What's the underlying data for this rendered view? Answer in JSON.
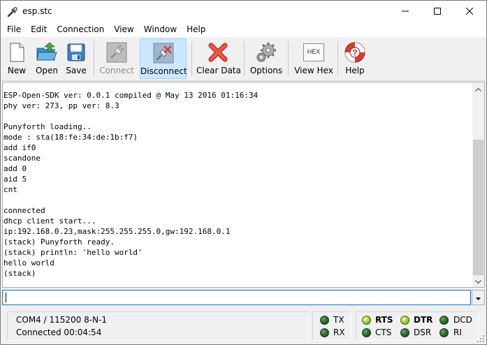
{
  "window": {
    "title": "esp.stc",
    "app_icon": "wrench-icon",
    "controls": {
      "minimize": "minimize-icon",
      "maximize": "maximize-icon",
      "close": "close-icon"
    }
  },
  "menu": {
    "items": [
      "File",
      "Edit",
      "Connection",
      "View",
      "Window",
      "Help"
    ]
  },
  "toolbar": {
    "new": {
      "label": "New",
      "icon": "new-document-icon"
    },
    "open": {
      "label": "Open",
      "icon": "open-folder-icon"
    },
    "save": {
      "label": "Save",
      "icon": "save-disk-icon"
    },
    "connect": {
      "label": "Connect",
      "icon": "plug-icon",
      "enabled": false
    },
    "disconnect": {
      "label": "Disconnect",
      "icon": "unplug-icon",
      "active": true
    },
    "clear": {
      "label": "Clear Data",
      "icon": "red-x-icon"
    },
    "options": {
      "label": "Options",
      "icon": "gears-icon"
    },
    "viewhex": {
      "label": "View Hex",
      "icon": "hex-icon",
      "icon_text": "HEX"
    },
    "help": {
      "label": "Help",
      "icon": "lifebuoy-icon"
    }
  },
  "terminal": {
    "lines": [
      "ESP-Open-SDK ver: 0.0.1 compiled @ May 13 2016 01:16:34",
      "phy ver: 273, pp ver: 8.3",
      "",
      "Punyforth loading..",
      "mode : sta(18:fe:34:de:1b:f7)",
      "add if0",
      "scandone",
      "add 0",
      "aid 5",
      "cnt",
      "",
      "connected",
      "dhcp client start...",
      "ip:192.168.0.23,mask:255.255.255.0,gw:192.168.0.1",
      "(stack) Punyforth ready.",
      "(stack) println: 'hello world'",
      "hello world",
      "(stack)"
    ]
  },
  "input": {
    "value": ""
  },
  "status": {
    "port": "COM4 / 115200 8-N-1",
    "connection": "Connected 00:04:54",
    "signals": {
      "tx": {
        "label": "TX",
        "on": false
      },
      "rx": {
        "label": "RX",
        "on": false
      },
      "rts": {
        "label": "RTS",
        "on": true
      },
      "cts": {
        "label": "CTS",
        "on": false
      },
      "dtr": {
        "label": "DTR",
        "on": true
      },
      "dsr": {
        "label": "DSR",
        "on": false
      },
      "dcd": {
        "label": "DCD",
        "on": false
      },
      "ri": {
        "label": "RI",
        "on": false
      }
    }
  }
}
